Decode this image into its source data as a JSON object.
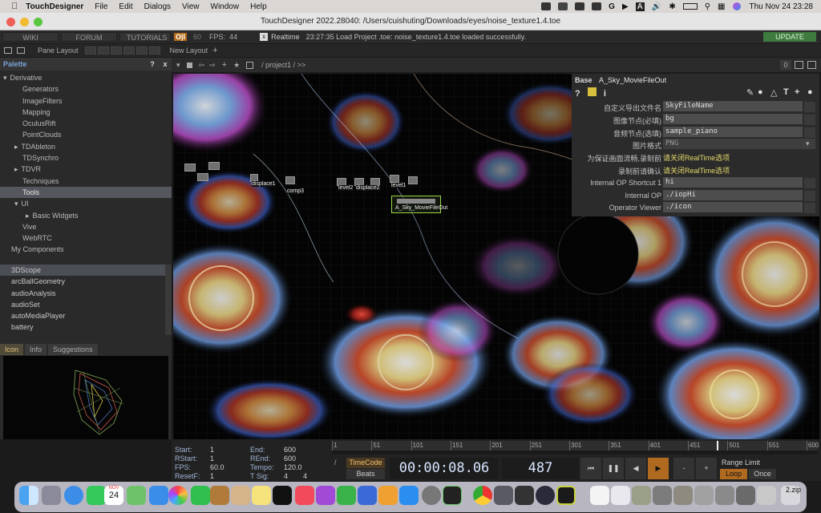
{
  "menubar": {
    "app": "TouchDesigner",
    "items": [
      "File",
      "Edit",
      "Dialogs",
      "View",
      "Window",
      "Help"
    ],
    "datetime": "Thu Nov 24  23:28",
    "tray_letters": [
      "G",
      "A"
    ]
  },
  "window": {
    "title": "TouchDesigner 2022.28040: /Users/cuishuting/Downloads/eyes/noise_texture1.4.toe"
  },
  "toolbar": {
    "wiki": "WIKI",
    "forum": "FORUM",
    "tutorials": "TUTORIALS",
    "oi": "O|I",
    "fps_cap": "60",
    "fps_label": "FPS:",
    "fps": "44",
    "realtime": "Realtime",
    "log": "23:27:35 Load Project .toe: noise_texture1.4.toe loaded successfully.",
    "update": "UPDATE"
  },
  "layoutbar": {
    "pane_layout": "Pane Layout",
    "new_layout": "New Layout",
    "add": "+"
  },
  "palette": {
    "title": "Palette",
    "help": "?",
    "close": "x",
    "tree": [
      {
        "label": "Derivative",
        "arrow": "▾",
        "indent": 4,
        "sel": false
      },
      {
        "label": "Generators",
        "arrow": "",
        "indent": 28,
        "sel": false
      },
      {
        "label": "ImageFilters",
        "arrow": "",
        "indent": 28,
        "sel": false
      },
      {
        "label": "Mapping",
        "arrow": "",
        "indent": 28,
        "sel": false
      },
      {
        "label": "OculusRift",
        "arrow": "",
        "indent": 28,
        "sel": false
      },
      {
        "label": "PointClouds",
        "arrow": "",
        "indent": 28,
        "sel": false
      },
      {
        "label": "TDAbleton",
        "arrow": "▸",
        "indent": 18,
        "sel": false
      },
      {
        "label": "TDSynchro",
        "arrow": "",
        "indent": 28,
        "sel": false
      },
      {
        "label": "TDVR",
        "arrow": "▸",
        "indent": 18,
        "sel": false
      },
      {
        "label": "Techniques",
        "arrow": "",
        "indent": 28,
        "sel": false
      },
      {
        "label": "Tools",
        "arrow": "",
        "indent": 28,
        "sel": true
      },
      {
        "label": "UI",
        "arrow": "▾",
        "indent": 18,
        "sel": false
      },
      {
        "label": "Basic Widgets",
        "arrow": "▸",
        "indent": 32,
        "sel": false
      },
      {
        "label": "Vive",
        "arrow": "",
        "indent": 28,
        "sel": false
      },
      {
        "label": "WebRTC",
        "arrow": "",
        "indent": 28,
        "sel": false
      },
      {
        "label": "My Components",
        "arrow": "",
        "indent": 14,
        "sel": false
      }
    ],
    "components": [
      "3DScope",
      "arcBallGeometry",
      "audioAnalysis",
      "audioSet",
      "autoMediaPlayer",
      "battery"
    ],
    "info_tabs": [
      "Icon",
      "Info",
      "Suggestions"
    ]
  },
  "network": {
    "path": "/ project1 / >>",
    "badge": "0",
    "nodes": [
      {
        "label": "displace1"
      },
      {
        "label": "comp3"
      },
      {
        "label": "level2"
      },
      {
        "label": "displace2"
      },
      {
        "label": "level1"
      },
      {
        "label": "A_Sky_MovieFileOut"
      }
    ]
  },
  "params": {
    "header_type": "Base",
    "header_name": "A_Sky_MovieFileOut",
    "rows": [
      {
        "label": "自定义导出文件名",
        "value": "SkyFileName",
        "kind": "field"
      },
      {
        "label": "图像节点(必填)",
        "value": "bg",
        "kind": "field"
      },
      {
        "label": "音频节点(选填)",
        "value": "sample_piano",
        "kind": "field"
      },
      {
        "label": "图片格式",
        "value": "PNG",
        "kind": "menu"
      },
      {
        "label": "为保证画面流畅,录制前",
        "value": "请关闭RealTime选项",
        "kind": "button"
      },
      {
        "label": "录制前请确认",
        "value": "请关闭RealTime选项",
        "kind": "button"
      },
      {
        "label": "Internal OP Shortcut 1",
        "value": "hi",
        "kind": "field"
      },
      {
        "label": "Internal OP",
        "value": "./iopHi",
        "kind": "field"
      },
      {
        "label": "Operator Viewer",
        "value": "./icon",
        "kind": "field"
      }
    ]
  },
  "timeline": {
    "start_label": "Start:",
    "start": "1",
    "rstart_label": "RStart:",
    "rstart": "1",
    "fps_label": "FPS:",
    "fps": "60.0",
    "resetf_label": "ResetF:",
    "resetf": "1",
    "end_label": "End:",
    "end": "600",
    "rend_label": "REnd:",
    "rend": "600",
    "tempo_label": "Tempo:",
    "tempo": "120.0",
    "tsig_label": "T Sig:",
    "tsig_a": "4",
    "tsig_b": "4",
    "ruler": [
      "1",
      "51",
      "101",
      "151",
      "201",
      "251",
      "301",
      "351",
      "401",
      "451",
      "501",
      "551",
      "600"
    ],
    "timecode_tab": "TimeCode",
    "beats_tab": "Beats",
    "timecode": "00:00:08.06",
    "frame": "487",
    "range_limit": "Range Limit",
    "loop": "Loop",
    "once": "Once"
  },
  "dock": {
    "calendar_month": "NOV",
    "calendar_day": "24",
    "trailing_text": "2.zip"
  }
}
